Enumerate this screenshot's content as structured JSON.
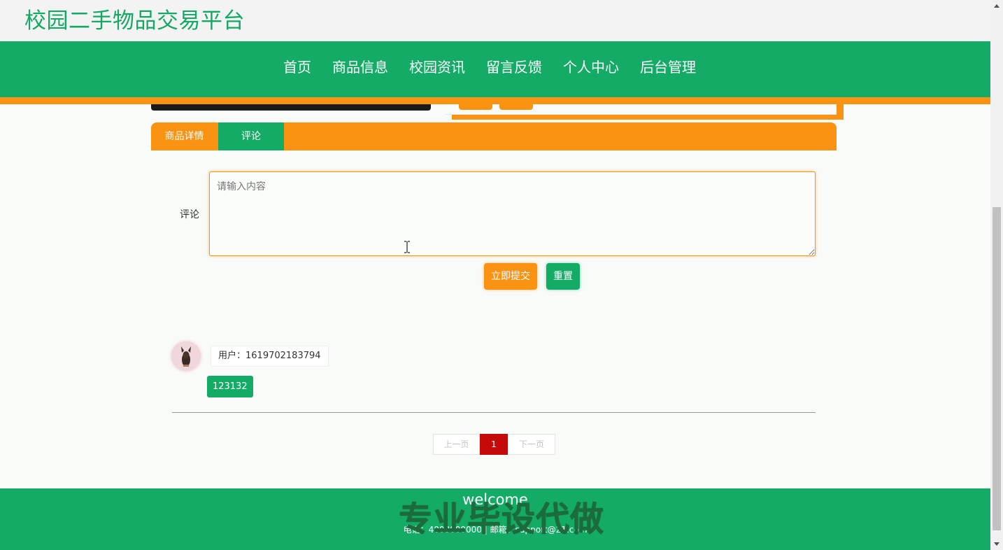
{
  "header": {
    "site_title": "校园二手物品交易平台"
  },
  "nav": {
    "items": [
      {
        "label": "首页"
      },
      {
        "label": "商品信息"
      },
      {
        "label": "校园资讯"
      },
      {
        "label": "留言反馈"
      },
      {
        "label": "个人中心"
      },
      {
        "label": "后台管理"
      }
    ]
  },
  "tabs": [
    {
      "label": "商品详情",
      "active": false
    },
    {
      "label": "评论",
      "active": true
    }
  ],
  "comment_form": {
    "label": "评论",
    "placeholder": "请输入内容",
    "value": "",
    "submit_label": "立即提交",
    "reset_label": "重置"
  },
  "comments": [
    {
      "user": "用户：1619702183794",
      "content": "123132"
    }
  ],
  "pagination": {
    "prev_label": "上一页",
    "current": "1",
    "next_label": "下一页"
  },
  "footer": {
    "welcome": "welcome",
    "contact": "电话：4008000000 | 邮箱：support@21.com"
  },
  "watermark": "专业毕设代做",
  "colors": {
    "brand_green": "#14ab66",
    "accent_orange": "#fa9212",
    "page_active_red": "#c40a0a"
  }
}
